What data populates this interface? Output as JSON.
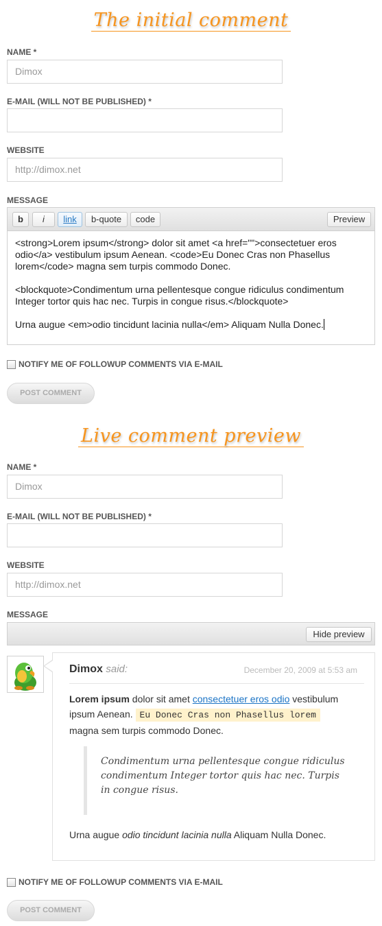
{
  "section1": {
    "heading": "The initial comment",
    "labels": {
      "name": "NAME *",
      "email": "E-MAIL (WILL NOT BE PUBLISHED) *",
      "website": "WEBSITE",
      "message": "MESSAGE"
    },
    "values": {
      "name": "Dimox",
      "email": "",
      "website": "http://dimox.net"
    },
    "toolbar": {
      "bold": "b",
      "italic": "i",
      "link": "link",
      "bquote": "b-quote",
      "code": "code",
      "preview": "Preview"
    },
    "message_lines": {
      "p1": "<strong>Lorem ipsum</strong> dolor sit amet <a href=\"\">consectetuer eros odio</a> vestibulum ipsum Aenean. <code>Eu Donec Cras non Phasellus lorem</code> magna sem turpis commodo Donec.",
      "p2": "<blockquote>Condimentum urna pellentesque congue ridiculus condimentum Integer tortor quis hac nec. Turpis in congue risus.</blockquote>",
      "p3": "Urna augue <em>odio tincidunt lacinia nulla</em> Aliquam Nulla Donec."
    },
    "notify": "NOTIFY ME OF FOLLOWUP COMMENTS VIA E-MAIL",
    "post": "POST COMMENT"
  },
  "section2": {
    "heading": "Live comment preview",
    "labels": {
      "name": "NAME *",
      "email": "E-MAIL (WILL NOT BE PUBLISHED) *",
      "website": "WEBSITE",
      "message": "MESSAGE"
    },
    "values": {
      "name": "Dimox",
      "email": "",
      "website": "http://dimox.net"
    },
    "hide_preview": "Hide preview",
    "comment": {
      "author": "Dimox",
      "said": "said:",
      "date": "December 20, 2009 at 5:53 am",
      "strong": "Lorem ipsum",
      "text1": " dolor sit amet ",
      "link": "consectetuer eros odio",
      "text2": " vestibulum ipsum Aenean. ",
      "code": "Eu Donec Cras non Phasellus lorem",
      "text3": " magna sem turpis commodo Donec.",
      "quote": "Condimentum urna pellentesque congue ridiculus condimentum Integer tortor quis hac nec. Turpis in congue risus.",
      "last_pre": "Urna augue ",
      "last_em": "odio tincidunt lacinia nulla",
      "last_post": " Aliquam Nulla Donec."
    },
    "notify": "NOTIFY ME OF FOLLOWUP COMMENTS VIA E-MAIL",
    "post": "POST COMMENT"
  },
  "colors": {
    "heading": "#f7941d",
    "link": "#1a73c5",
    "code_bg": "#fff2cc"
  }
}
